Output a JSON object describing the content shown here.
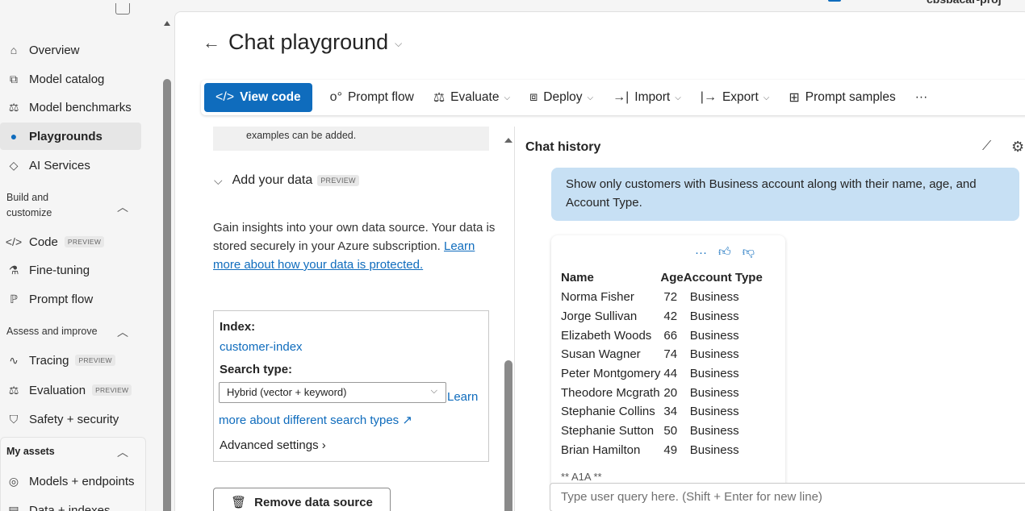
{
  "project": {
    "name": "cbsbacar-proj"
  },
  "nav": {
    "items": [
      {
        "label": "Overview",
        "icon": "overview-icon"
      },
      {
        "label": "Model catalog",
        "icon": "model-catalog-icon"
      },
      {
        "label": "Model benchmarks",
        "icon": "benchmarks-icon"
      },
      {
        "label": "Playgrounds",
        "icon": "playgrounds-icon"
      },
      {
        "label": "AI Services",
        "icon": "ai-services-icon"
      }
    ],
    "section_build": "Build and customize",
    "build_items": [
      {
        "label": "Code",
        "badge": "PREVIEW"
      },
      {
        "label": "Fine-tuning"
      },
      {
        "label": "Prompt flow"
      }
    ],
    "section_assess": "Assess and improve",
    "assess_items": [
      {
        "label": "Tracing",
        "badge": "PREVIEW"
      },
      {
        "label": "Evaluation",
        "badge": "PREVIEW"
      },
      {
        "label": "Safety + security"
      }
    ],
    "section_assets": "My assets",
    "asset_items": [
      {
        "label": "Models + endpoints"
      },
      {
        "label": "Data + indexes"
      }
    ]
  },
  "page": {
    "title": "Chat playground"
  },
  "toolbar": {
    "view_code": "View code",
    "prompt_flow": "Prompt flow",
    "evaluate": "Evaluate",
    "deploy": "Deploy",
    "import": "Import",
    "export": "Export",
    "prompt_samples": "Prompt samples",
    "more": "···"
  },
  "setup": {
    "note": "examples can be added.",
    "add_data_title": "Add your data",
    "add_data_badge": "PREVIEW",
    "description": "Gain insights into your own data source. Your data is stored securely in your Azure subscription.",
    "description_link": "Learn more about how your data is protected.",
    "index_label": "Index:",
    "index_value": "customer-index",
    "search_type_label": "Search type:",
    "search_type_value": "Hybrid (vector + keyword)",
    "search_learn_link": "Learn more about different search types",
    "advanced_settings": "Advanced settings",
    "remove_button": "Remove data source"
  },
  "chat": {
    "header": "Chat history",
    "user_message": "Show only customers with Business account  along with their name, age, and Account Type.",
    "table": {
      "columns": [
        "Name",
        "Age",
        "Account Type"
      ],
      "rows": [
        [
          "Norma Fisher",
          "72",
          "Business"
        ],
        [
          "Jorge Sullivan",
          "42",
          "Business"
        ],
        [
          "Elizabeth Woods",
          "66",
          "Business"
        ],
        [
          "Susan Wagner",
          "74",
          "Business"
        ],
        [
          "Peter Montgomery",
          "44",
          "Business"
        ],
        [
          "Theodore Mcgrath",
          "20",
          "Business"
        ],
        [
          "Stephanie Collins",
          "34",
          "Business"
        ],
        [
          "Stephanie Sutton",
          "50",
          "Business"
        ],
        [
          "Brian Hamilton",
          "49",
          "Business"
        ]
      ],
      "footer": "** A1A **"
    },
    "input_placeholder": "Type user query here. (Shift + Enter for new line)"
  },
  "colors": {
    "accent": "#0f6cbd",
    "user_bubble": "#c7e0f4"
  }
}
